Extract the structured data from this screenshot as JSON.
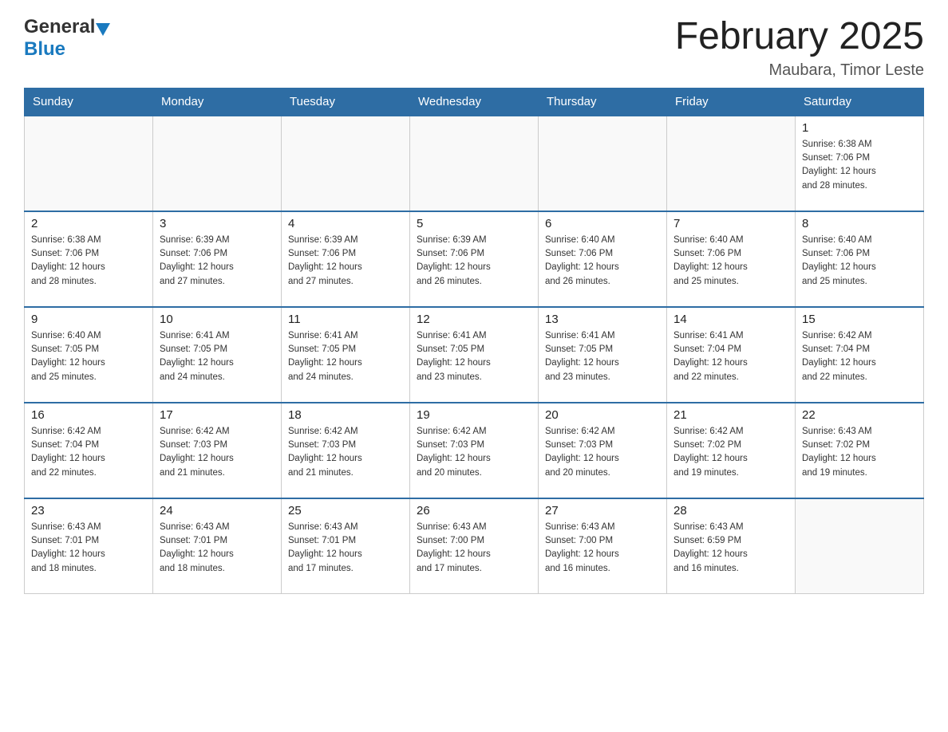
{
  "header": {
    "logo_general": "General",
    "logo_blue": "Blue",
    "month_title": "February 2025",
    "location": "Maubara, Timor Leste"
  },
  "weekdays": [
    "Sunday",
    "Monday",
    "Tuesday",
    "Wednesday",
    "Thursday",
    "Friday",
    "Saturday"
  ],
  "weeks": [
    [
      {
        "day": "",
        "info": ""
      },
      {
        "day": "",
        "info": ""
      },
      {
        "day": "",
        "info": ""
      },
      {
        "day": "",
        "info": ""
      },
      {
        "day": "",
        "info": ""
      },
      {
        "day": "",
        "info": ""
      },
      {
        "day": "1",
        "info": "Sunrise: 6:38 AM\nSunset: 7:06 PM\nDaylight: 12 hours\nand 28 minutes."
      }
    ],
    [
      {
        "day": "2",
        "info": "Sunrise: 6:38 AM\nSunset: 7:06 PM\nDaylight: 12 hours\nand 28 minutes."
      },
      {
        "day": "3",
        "info": "Sunrise: 6:39 AM\nSunset: 7:06 PM\nDaylight: 12 hours\nand 27 minutes."
      },
      {
        "day": "4",
        "info": "Sunrise: 6:39 AM\nSunset: 7:06 PM\nDaylight: 12 hours\nand 27 minutes."
      },
      {
        "day": "5",
        "info": "Sunrise: 6:39 AM\nSunset: 7:06 PM\nDaylight: 12 hours\nand 26 minutes."
      },
      {
        "day": "6",
        "info": "Sunrise: 6:40 AM\nSunset: 7:06 PM\nDaylight: 12 hours\nand 26 minutes."
      },
      {
        "day": "7",
        "info": "Sunrise: 6:40 AM\nSunset: 7:06 PM\nDaylight: 12 hours\nand 25 minutes."
      },
      {
        "day": "8",
        "info": "Sunrise: 6:40 AM\nSunset: 7:06 PM\nDaylight: 12 hours\nand 25 minutes."
      }
    ],
    [
      {
        "day": "9",
        "info": "Sunrise: 6:40 AM\nSunset: 7:05 PM\nDaylight: 12 hours\nand 25 minutes."
      },
      {
        "day": "10",
        "info": "Sunrise: 6:41 AM\nSunset: 7:05 PM\nDaylight: 12 hours\nand 24 minutes."
      },
      {
        "day": "11",
        "info": "Sunrise: 6:41 AM\nSunset: 7:05 PM\nDaylight: 12 hours\nand 24 minutes."
      },
      {
        "day": "12",
        "info": "Sunrise: 6:41 AM\nSunset: 7:05 PM\nDaylight: 12 hours\nand 23 minutes."
      },
      {
        "day": "13",
        "info": "Sunrise: 6:41 AM\nSunset: 7:05 PM\nDaylight: 12 hours\nand 23 minutes."
      },
      {
        "day": "14",
        "info": "Sunrise: 6:41 AM\nSunset: 7:04 PM\nDaylight: 12 hours\nand 22 minutes."
      },
      {
        "day": "15",
        "info": "Sunrise: 6:42 AM\nSunset: 7:04 PM\nDaylight: 12 hours\nand 22 minutes."
      }
    ],
    [
      {
        "day": "16",
        "info": "Sunrise: 6:42 AM\nSunset: 7:04 PM\nDaylight: 12 hours\nand 22 minutes."
      },
      {
        "day": "17",
        "info": "Sunrise: 6:42 AM\nSunset: 7:03 PM\nDaylight: 12 hours\nand 21 minutes."
      },
      {
        "day": "18",
        "info": "Sunrise: 6:42 AM\nSunset: 7:03 PM\nDaylight: 12 hours\nand 21 minutes."
      },
      {
        "day": "19",
        "info": "Sunrise: 6:42 AM\nSunset: 7:03 PM\nDaylight: 12 hours\nand 20 minutes."
      },
      {
        "day": "20",
        "info": "Sunrise: 6:42 AM\nSunset: 7:03 PM\nDaylight: 12 hours\nand 20 minutes."
      },
      {
        "day": "21",
        "info": "Sunrise: 6:42 AM\nSunset: 7:02 PM\nDaylight: 12 hours\nand 19 minutes."
      },
      {
        "day": "22",
        "info": "Sunrise: 6:43 AM\nSunset: 7:02 PM\nDaylight: 12 hours\nand 19 minutes."
      }
    ],
    [
      {
        "day": "23",
        "info": "Sunrise: 6:43 AM\nSunset: 7:01 PM\nDaylight: 12 hours\nand 18 minutes."
      },
      {
        "day": "24",
        "info": "Sunrise: 6:43 AM\nSunset: 7:01 PM\nDaylight: 12 hours\nand 18 minutes."
      },
      {
        "day": "25",
        "info": "Sunrise: 6:43 AM\nSunset: 7:01 PM\nDaylight: 12 hours\nand 17 minutes."
      },
      {
        "day": "26",
        "info": "Sunrise: 6:43 AM\nSunset: 7:00 PM\nDaylight: 12 hours\nand 17 minutes."
      },
      {
        "day": "27",
        "info": "Sunrise: 6:43 AM\nSunset: 7:00 PM\nDaylight: 12 hours\nand 16 minutes."
      },
      {
        "day": "28",
        "info": "Sunrise: 6:43 AM\nSunset: 6:59 PM\nDaylight: 12 hours\nand 16 minutes."
      },
      {
        "day": "",
        "info": ""
      }
    ]
  ],
  "colors": {
    "header_bg": "#2e6da4",
    "header_text": "#ffffff",
    "border": "#cccccc"
  }
}
